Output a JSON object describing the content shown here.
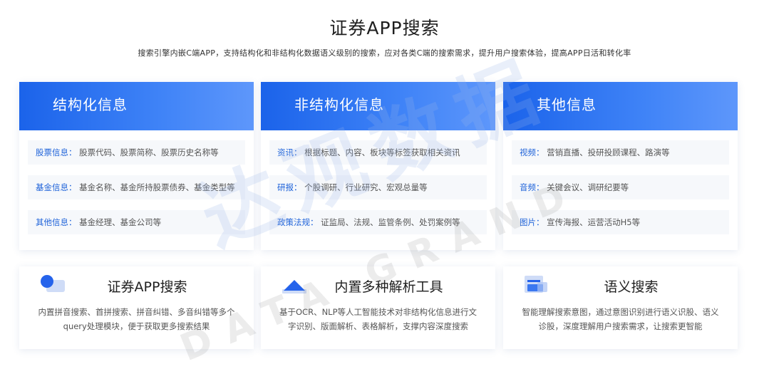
{
  "header": {
    "title": "证券APP搜索",
    "subtitle": "搜索引擎内嵌C端APP，支持结构化和非结构化数据语义级别的搜索，应对各类C端的搜索需求，提升用户搜索体验，提高APP日活和转化率"
  },
  "colors": {
    "accent": "#1b63ea",
    "key_text": "#1e62d9",
    "row_bg": "#f6f8fb"
  },
  "cards": [
    {
      "title": "结构化信息",
      "rows": [
        {
          "key": "股票信息：",
          "value": "股票代码、股票简称、股票历史名称等"
        },
        {
          "key": "基金信息：",
          "value": "基金名称、基金所持股票债券、基金类型等"
        },
        {
          "key": "其他信息：",
          "value": "基金经理、基金公司等"
        }
      ]
    },
    {
      "title": "非结构化信息",
      "rows": [
        {
          "key": "资讯：",
          "value": "根据标题、内容、板块等标签获取相关资讯"
        },
        {
          "key": "研报：",
          "value": "个股调研、行业研究、宏观总量等"
        },
        {
          "key": "政策法规：",
          "value": "证监局、法规、监管条例、处罚案例等"
        }
      ]
    },
    {
      "title": "其他信息",
      "rows": [
        {
          "key": "视频：",
          "value": "营销直播、投研投顾课程、路演等"
        },
        {
          "key": "音频：",
          "value": "关键会议、调研纪要等"
        },
        {
          "key": "图片：",
          "value": "宣传海报、运营活动H5等"
        }
      ]
    }
  ],
  "features": [
    {
      "icon": "search-bubble-icon",
      "title": "证券APP搜索",
      "desc": "内置拼音搜索、首拼搜索、拼音纠错、多音纠错等多个query处理模块，便于获取更多搜索结果"
    },
    {
      "icon": "mountain-parse-icon",
      "title": "内置多种解析工具",
      "desc": "基于OCR、NLP等人工智能技术对非结构化信息进行文字识别、版面解析、表格解析，支撑内容深度搜索"
    },
    {
      "icon": "document-semantic-icon",
      "title": "语义搜索",
      "desc": "智能理解搜索意图，通过意图识别进行语义识股、语义诊股，深度理解用户搜索需求，让搜索更智能"
    }
  ],
  "watermark": {
    "cn": "达观数据",
    "en": "DATA GRAND"
  }
}
